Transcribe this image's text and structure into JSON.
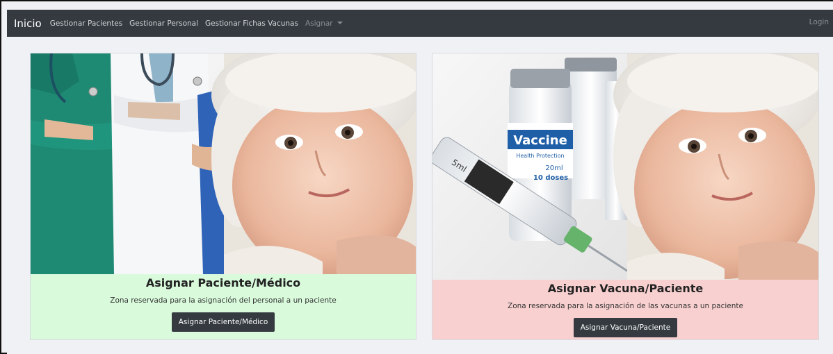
{
  "navbar": {
    "brand": "Inicio",
    "links": [
      "Gestionar Pacientes",
      "Gestionar Personal",
      "Gestionar Fichas Vacunas"
    ],
    "dropdown": "Asignar",
    "login": "Login"
  },
  "cards": [
    {
      "title": "Asignar Paciente/Médico",
      "text": "Zona reservada para la asignación del personal a un paciente",
      "button": "Asignar Paciente/Médico",
      "image_caption": "Doctors and baby photo"
    },
    {
      "title": "Asignar Vacuna/Paciente",
      "text": "Zona reservada para la asignación de las vacunas a un paciente",
      "button": "Asignar Vacuna/Paciente",
      "vial_label": "Vaccine",
      "vial_sub": "Health Protection",
      "vial_dose": "20ml",
      "vial_doses": "10 doses",
      "syringe_mark": "5ml"
    }
  ],
  "colors": {
    "navbar": "#343a40",
    "card_green": "#d9fbdc",
    "card_red": "#f9d0d0"
  }
}
